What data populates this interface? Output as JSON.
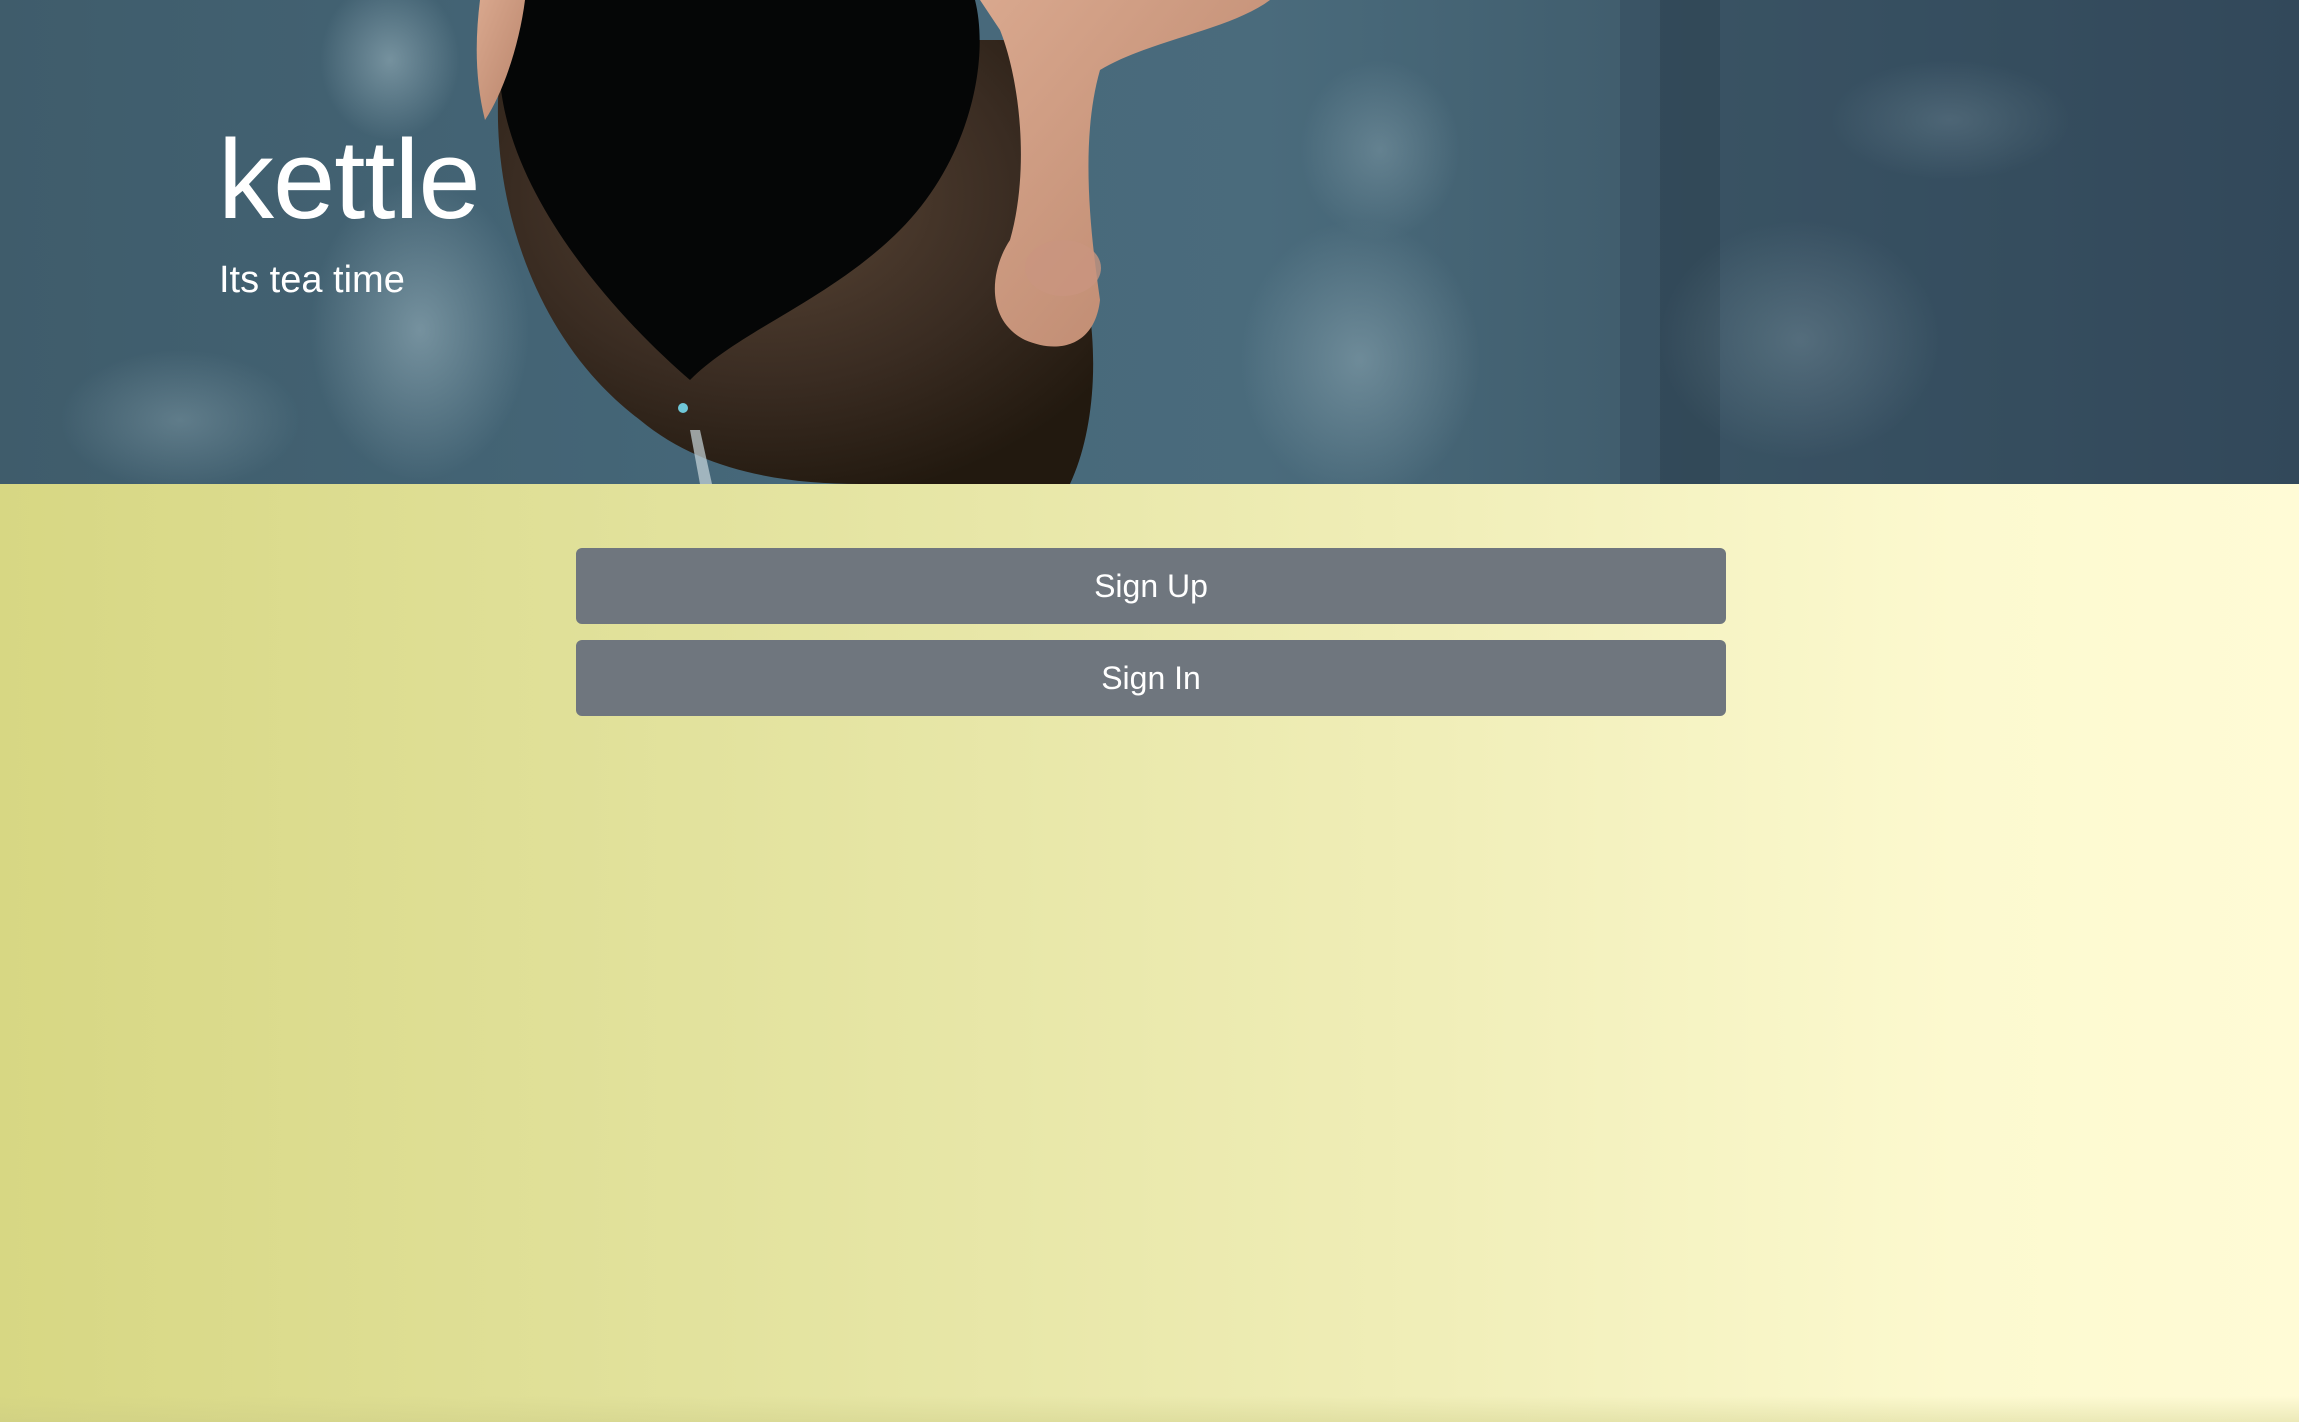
{
  "hero": {
    "title": "kettle",
    "subtitle": "Its tea time"
  },
  "actions": {
    "sign_up_label": "Sign Up",
    "sign_in_label": "Sign In"
  },
  "colors": {
    "hero_bg": "#46687a",
    "body_gradient_start": "#d7d783",
    "body_gradient_end": "#fffbd6",
    "button_bg": "#6f767e",
    "button_text": "#ffffff"
  }
}
